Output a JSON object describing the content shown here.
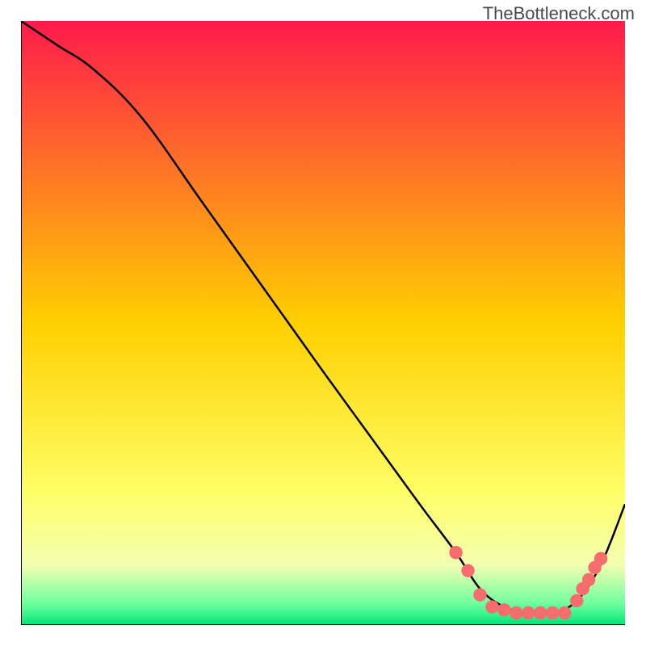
{
  "watermark": "TheBottleneck.com",
  "chart_data": {
    "type": "line",
    "title": "",
    "xlabel": "",
    "ylabel": "",
    "xlim": [
      0,
      100
    ],
    "ylim": [
      0,
      100
    ],
    "background_gradient": {
      "stops": [
        {
          "offset": 0.0,
          "color": "#ff1a4b"
        },
        {
          "offset": 0.5,
          "color": "#ffd000"
        },
        {
          "offset": 0.78,
          "color": "#ffff66"
        },
        {
          "offset": 0.9,
          "color": "#f4ffb0"
        },
        {
          "offset": 0.965,
          "color": "#6fff9f"
        },
        {
          "offset": 1.0,
          "color": "#00e676"
        }
      ]
    },
    "series": [
      {
        "name": "curve",
        "color": "#000000",
        "x": [
          0,
          6,
          12,
          20,
          30,
          40,
          50,
          58,
          66,
          72,
          76,
          80,
          84,
          88,
          92,
          96,
          100
        ],
        "y": [
          100,
          96,
          92,
          84,
          70,
          56,
          42,
          31,
          20,
          12,
          6,
          3,
          2,
          2,
          4,
          10,
          20
        ]
      }
    ],
    "markers": {
      "name": "dots",
      "color": "#f76c6c",
      "radius_pct": 1.1,
      "points": [
        {
          "x": 72,
          "y": 12
        },
        {
          "x": 74,
          "y": 9
        },
        {
          "x": 76,
          "y": 5
        },
        {
          "x": 78,
          "y": 3
        },
        {
          "x": 80,
          "y": 2.5
        },
        {
          "x": 82,
          "y": 2
        },
        {
          "x": 84,
          "y": 2
        },
        {
          "x": 86,
          "y": 2
        },
        {
          "x": 88,
          "y": 2
        },
        {
          "x": 90,
          "y": 2
        },
        {
          "x": 92,
          "y": 4
        },
        {
          "x": 93,
          "y": 6
        },
        {
          "x": 94,
          "y": 7.5
        },
        {
          "x": 95,
          "y": 9.5
        },
        {
          "x": 96,
          "y": 11
        }
      ]
    }
  }
}
